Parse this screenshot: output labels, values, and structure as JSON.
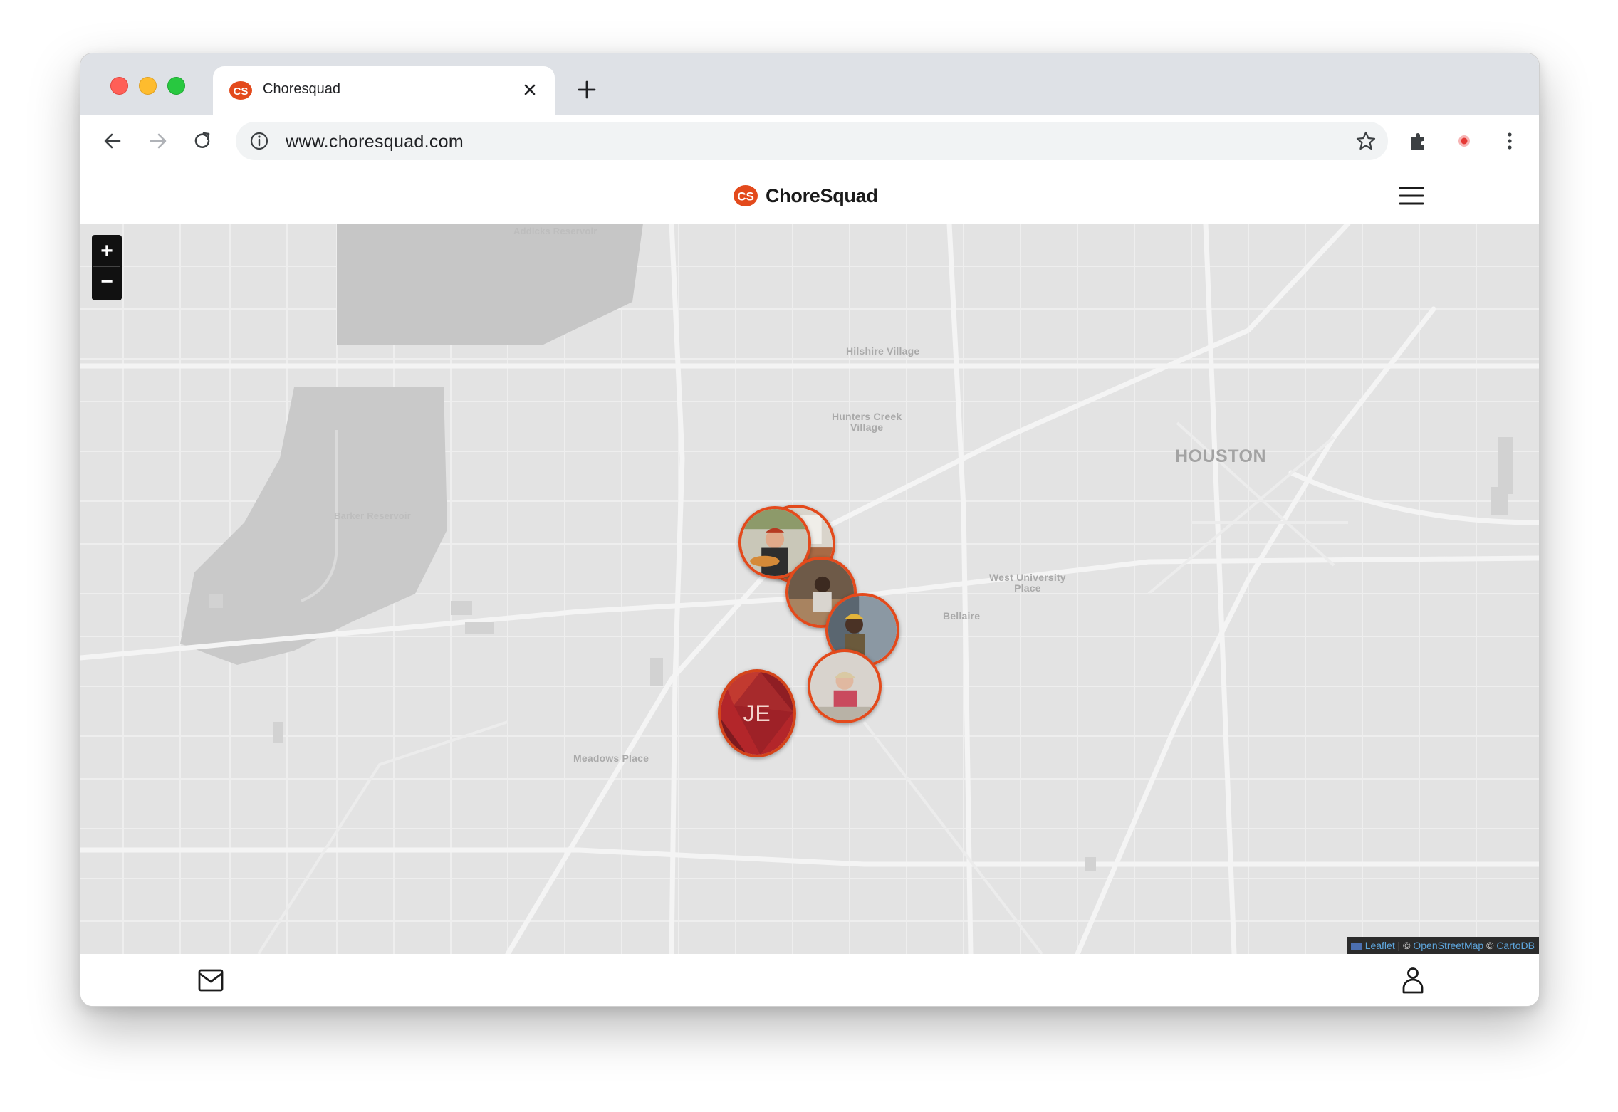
{
  "browser": {
    "tab": {
      "title": "Choresquad",
      "favicon": "choresquad-cs-logo"
    },
    "url": "www.choresquad.com",
    "icons": [
      "back-icon",
      "forward-icon",
      "reload-icon",
      "site-info-icon",
      "bookmark-star-icon",
      "extensions-puzzle-icon",
      "extension-record-icon",
      "browser-menu-icon"
    ]
  },
  "header": {
    "logo_text": "CS",
    "brand_name": "ChoreSquad",
    "menu_icon": "hamburger-menu-icon"
  },
  "map": {
    "zoom_in_label": "+",
    "zoom_out_label": "−",
    "places": {
      "city": "HOUSTON",
      "hilshire_village": "Hilshire Village",
      "hunters_creek_line1": "Hunters Creek",
      "hunters_creek_line2": "Village",
      "west_university_line1": "West University",
      "west_university_line2": "Place",
      "bellaire": "Bellaire",
      "meadows_place": "Meadows Place",
      "barker_reservoir": "Barker Reservoir",
      "addicks_reservoir": "Addicks Reservoir"
    },
    "markers": [
      {
        "name": "worker-photo-kitchen"
      },
      {
        "name": "worker-photo-cooking"
      },
      {
        "name": "worker-photo-woodwork"
      },
      {
        "name": "worker-photo-mechanic"
      },
      {
        "name": "worker-photo-crafts"
      }
    ],
    "current_user_initials": "JE",
    "attribution": {
      "leaflet": "Leaflet",
      "sep1": " | © ",
      "osm": "OpenStreetMap",
      "sep2": " © ",
      "carto": "CartoDB"
    }
  },
  "bottom_nav": {
    "icons": [
      "messages-envelope-icon",
      "profile-person-icon"
    ]
  },
  "colors": {
    "brand_orange": "#e34a1c",
    "map_background": "#e3e3e3",
    "water": "#c4c4c4"
  }
}
